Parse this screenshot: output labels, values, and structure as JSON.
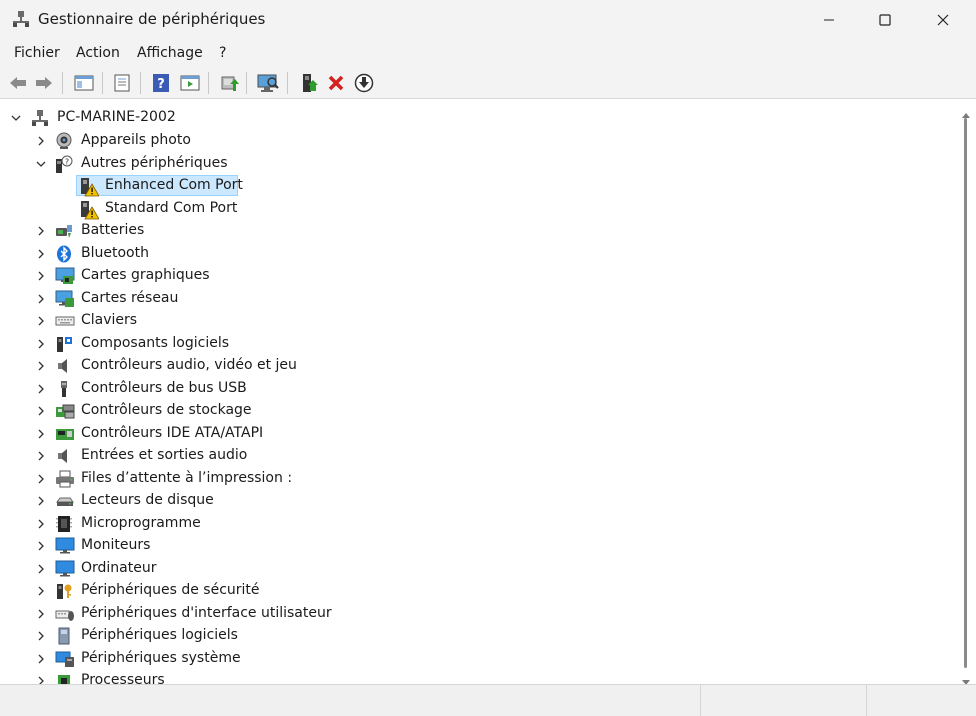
{
  "window": {
    "title": "Gestionnaire de périphériques",
    "controls": {
      "minimize": "minimize",
      "maximize": "maximize",
      "close": "close"
    }
  },
  "menu": [
    "Fichier",
    "Action",
    "Affichage",
    "?"
  ],
  "toolbar": [
    "back-arrow-icon",
    "forward-arrow-icon",
    "show-hide-console-tree-icon",
    "properties-icon",
    "help-icon",
    "action-pane-icon",
    "update-driver-icon",
    "scan-hardware-icon",
    "enable-device-icon",
    "uninstall-device-icon",
    "disable-device-icon"
  ],
  "tree": {
    "root": {
      "label": "PC-MARINE-2002"
    },
    "items": [
      {
        "label": "Appareils photo",
        "icon": "camera-icon"
      },
      {
        "label": "Autres périphériques",
        "icon": "unknown-device-icon",
        "expanded": true,
        "children": [
          {
            "label": "Enhanced Com Port",
            "icon": "warning-device-icon",
            "selected": true
          },
          {
            "label": "Standard Com Port",
            "icon": "warning-device-icon"
          }
        ]
      },
      {
        "label": "Batteries",
        "icon": "battery-icon"
      },
      {
        "label": "Bluetooth",
        "icon": "bluetooth-icon"
      },
      {
        "label": "Cartes graphiques",
        "icon": "display-adapter-icon"
      },
      {
        "label": "Cartes réseau",
        "icon": "network-adapter-icon"
      },
      {
        "label": "Claviers",
        "icon": "keyboard-icon"
      },
      {
        "label": "Composants logiciels",
        "icon": "software-component-icon"
      },
      {
        "label": "Contrôleurs audio, vidéo et jeu",
        "icon": "speaker-icon"
      },
      {
        "label": "Contrôleurs de bus USB",
        "icon": "usb-icon"
      },
      {
        "label": "Contrôleurs de stockage",
        "icon": "storage-controller-icon"
      },
      {
        "label": "Contrôleurs IDE ATA/ATAPI",
        "icon": "ide-controller-icon"
      },
      {
        "label": "Entrées et sorties audio",
        "icon": "speaker-icon"
      },
      {
        "label": "Files d’attente à l’impression :",
        "icon": "printer-icon"
      },
      {
        "label": "Lecteurs de disque",
        "icon": "disk-drive-icon"
      },
      {
        "label": "Microprogramme",
        "icon": "firmware-icon"
      },
      {
        "label": "Moniteurs",
        "icon": "monitor-icon"
      },
      {
        "label": "Ordinateur",
        "icon": "monitor-icon"
      },
      {
        "label": "Périphériques de sécurité",
        "icon": "security-key-icon"
      },
      {
        "label": "Périphériques d'interface utilisateur",
        "icon": "hid-icon"
      },
      {
        "label": "Périphériques logiciels",
        "icon": "software-device-icon"
      },
      {
        "label": "Périphériques système",
        "icon": "system-device-icon"
      },
      {
        "label": "Processeurs",
        "icon": "processor-icon"
      }
    ]
  },
  "colors": {
    "selection_bg": "#cce8ff",
    "selection_border": "#99d1ff",
    "chrome_bg": "#f3f3f3"
  }
}
